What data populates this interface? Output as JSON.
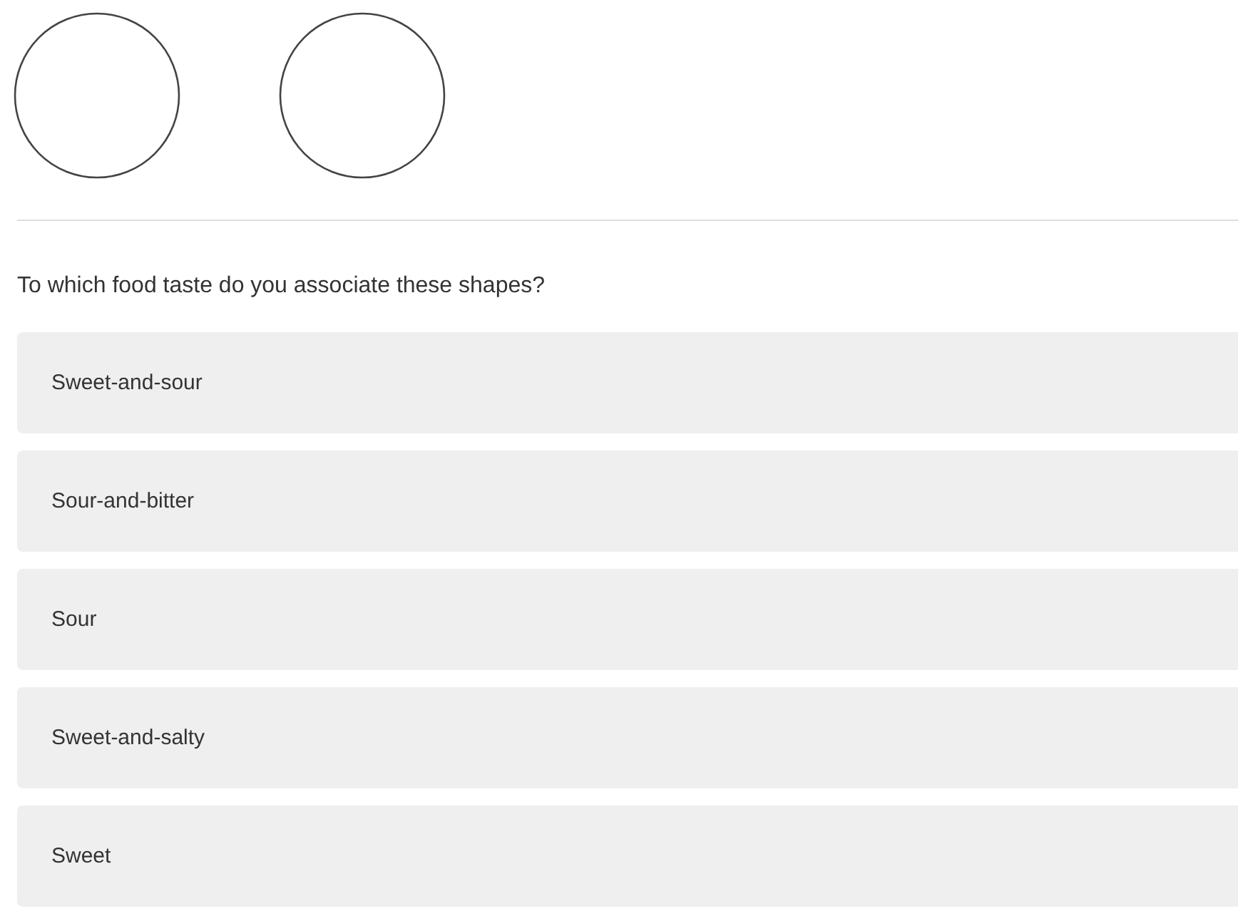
{
  "shapes": [
    {
      "kind": "circle"
    },
    {
      "kind": "circle"
    }
  ],
  "question": "To which food taste do you associate these shapes?",
  "options": [
    {
      "label": "Sweet-and-sour"
    },
    {
      "label": "Sour-and-bitter"
    },
    {
      "label": "Sour"
    },
    {
      "label": "Sweet-and-salty"
    },
    {
      "label": "Sweet"
    }
  ]
}
